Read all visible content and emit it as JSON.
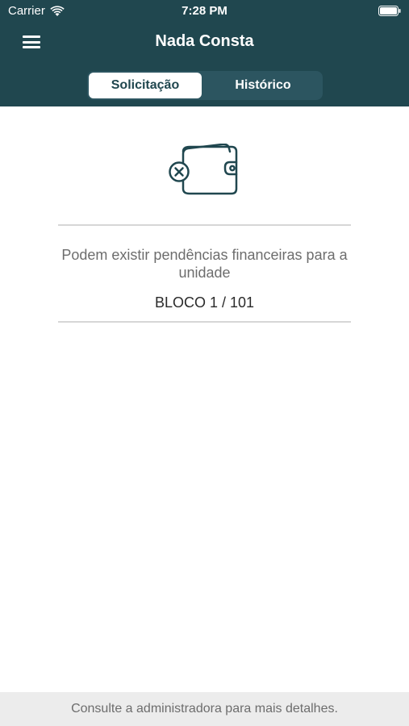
{
  "status_bar": {
    "carrier": "Carrier",
    "time": "7:28 PM"
  },
  "header": {
    "title": "Nada Consta",
    "menu_icon": "hamburger-menu-icon",
    "background_color": "#20474f"
  },
  "tabs": [
    {
      "label": "Solicitação",
      "active": true
    },
    {
      "label": "Histórico",
      "active": false
    }
  ],
  "main": {
    "icon": "wallet-error-icon",
    "message": "Podem existir pendências financeiras para a unidade",
    "unit": "BLOCO 1 / 101"
  },
  "footer": {
    "text": "Consulte a administradora para mais detalhes."
  }
}
